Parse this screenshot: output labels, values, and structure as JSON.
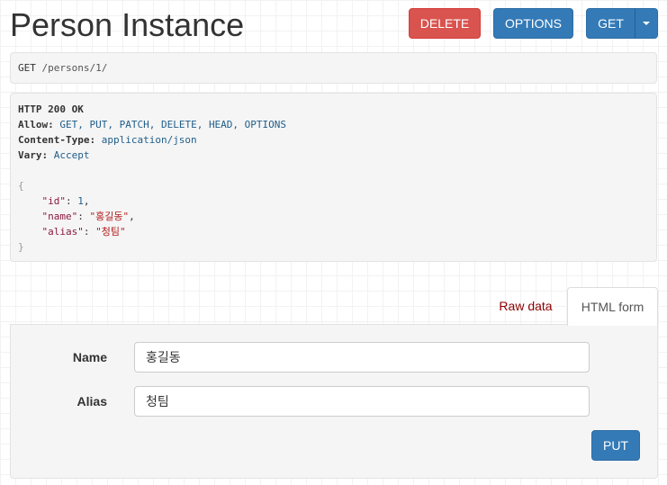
{
  "page": {
    "title": "Person Instance"
  },
  "toolbar": {
    "delete_label": "DELETE",
    "options_label": "OPTIONS",
    "get_label": "GET"
  },
  "request": {
    "method": "GET",
    "path": "/persons/1/"
  },
  "response": {
    "status_line": "HTTP 200 OK",
    "headers": [
      {
        "name": "Allow:",
        "value": "GET, PUT, PATCH, DELETE, HEAD, OPTIONS"
      },
      {
        "name": "Content-Type:",
        "value": "application/json"
      },
      {
        "name": "Vary:",
        "value": "Accept"
      }
    ],
    "body": {
      "open_brace": "{",
      "close_brace": "}",
      "fields": [
        {
          "key": "\"id\"",
          "value": "1",
          "type": "number",
          "sep": ","
        },
        {
          "key": "\"name\"",
          "value": "\"홍길동\"",
          "type": "string",
          "sep": ","
        },
        {
          "key": "\"alias\"",
          "value": "\"청팀\"",
          "type": "string",
          "sep": ""
        }
      ]
    }
  },
  "tabs": {
    "raw_data": "Raw data",
    "html_form": "HTML form"
  },
  "form": {
    "name_label": "Name",
    "name_value": "홍길동",
    "alias_label": "Alias",
    "alias_value": "청팀",
    "submit_label": "PUT"
  },
  "colors": {
    "primary": "#337ab7",
    "danger": "#d9534f",
    "raw_tab_text": "#8b0000"
  }
}
